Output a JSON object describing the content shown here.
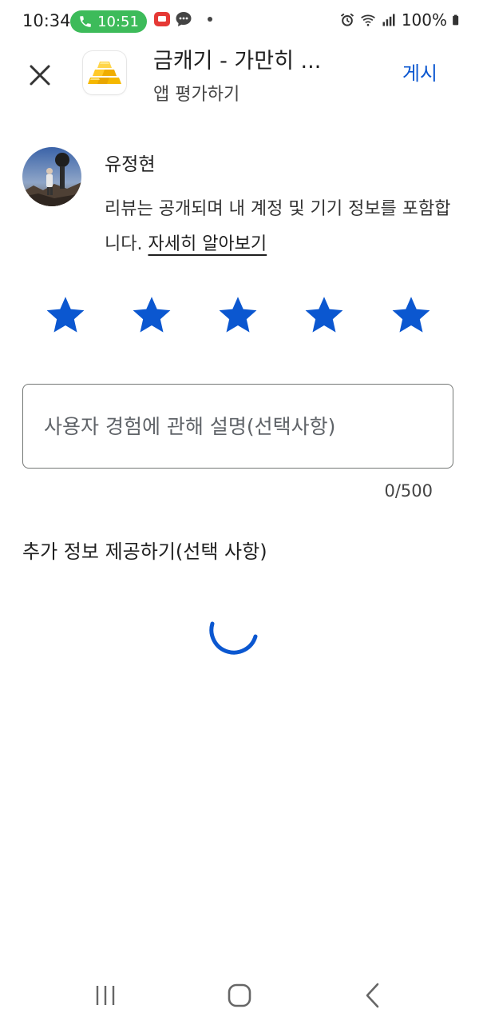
{
  "status_bar": {
    "time": "10:34",
    "call_time": "10:51",
    "battery": "100%"
  },
  "header": {
    "app_title": "금캐기 - 가만히 ...",
    "subtitle": "앱 평가하기",
    "post_label": "게시"
  },
  "reviewer": {
    "name": "유정현",
    "notice_text": "리뷰는 공개되며 내 계정 및 기기 정보를 포함합니다.",
    "learn_more": "자세히 알아보기"
  },
  "rating": {
    "selected_stars": 5,
    "max_stars": 5,
    "star_color": "#0b57d0"
  },
  "review_field": {
    "placeholder": "사용자 경험에 관해 설명(선택사항)",
    "value": "",
    "char_count": "0/500"
  },
  "extra_info": {
    "label": "추가 정보 제공하기(선택 사항)"
  },
  "colors": {
    "accent": "#0b57d0",
    "call_pill": "#3dbb5a"
  }
}
